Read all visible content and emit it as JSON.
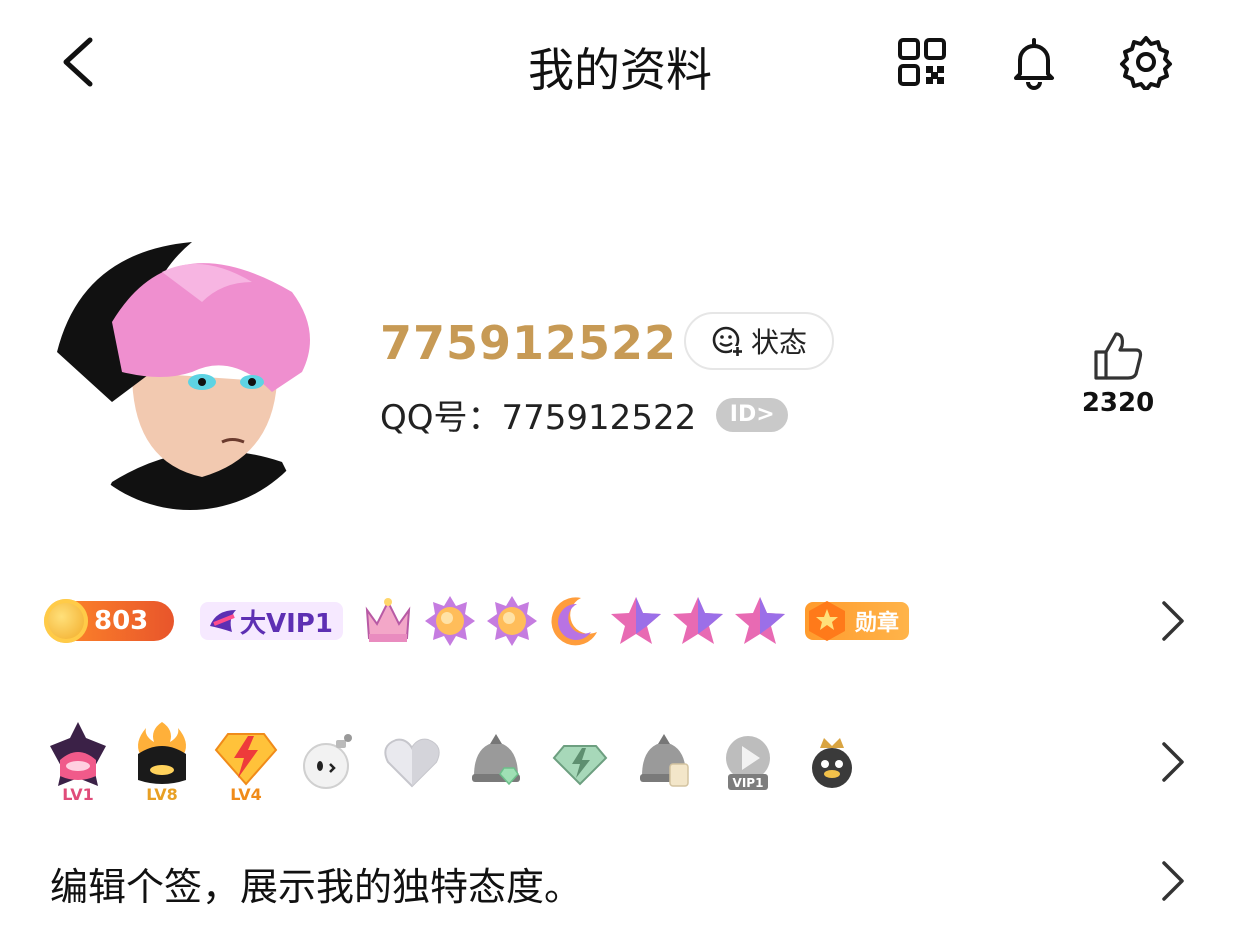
{
  "header": {
    "title": "我的资料",
    "back_icon": "chevron-left-icon",
    "icons": [
      "qr-code-icon",
      "bell-icon",
      "gear-icon"
    ]
  },
  "profile": {
    "nickname": "775912522",
    "status_label": "状态",
    "qq_label": "QQ号：775912522",
    "id_badge": "ID>",
    "like_count": "2320"
  },
  "badges_row1": {
    "coin_value": "803",
    "vip_label": "大VIP1",
    "medal_label": "勋章",
    "level_icons": [
      "crown-icon",
      "sun-icon",
      "sun-icon",
      "moon-icon",
      "star-icon",
      "star-icon",
      "star-icon"
    ]
  },
  "badges_row2": {
    "items": [
      {
        "icon": "game-lv1-icon",
        "label": "LV1"
      },
      {
        "icon": "game-lv8-icon",
        "label": "LV8"
      },
      {
        "icon": "lightning-diamond-icon",
        "label": "LV4"
      },
      {
        "icon": "bomb-face-icon",
        "label": ""
      },
      {
        "icon": "heart-icon",
        "label": ""
      },
      {
        "icon": "helmet-gem-icon",
        "label": ""
      },
      {
        "icon": "diamond-icon",
        "label": ""
      },
      {
        "icon": "helmet-note-icon",
        "label": ""
      },
      {
        "icon": "video-vip-icon",
        "label": "VIP1"
      },
      {
        "icon": "penguin-crown-icon",
        "label": ""
      }
    ]
  },
  "signature": {
    "placeholder": "编辑个签，展示我的独特态度。"
  },
  "colors": {
    "nickname": "#c79a55",
    "coin": "#e8552b",
    "vip": "#5d2fb3"
  }
}
